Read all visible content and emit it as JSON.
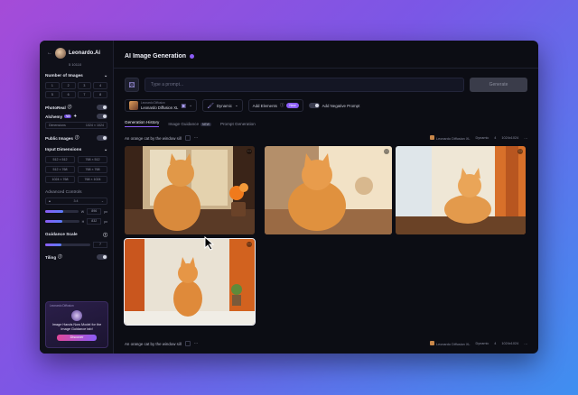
{
  "sidebar": {
    "brand": "Leonardo.Ai",
    "tokens": "5 10110",
    "number_of_images_label": "Number of Images",
    "image_counts": [
      "1",
      "2",
      "3",
      "4",
      "5",
      "6",
      "7",
      "8"
    ],
    "photoreal_label": "PhotoReal",
    "alchemy_label": "Alchemy",
    "alchemy_badge": "V2",
    "size_left": "Dimensions",
    "size_right": "1024 × 1024",
    "public_images_label": "Public Images",
    "input_dimensions_label": "Input Dimensions",
    "dimension_options": [
      "512 × 512",
      "768 × 512",
      "512 × 768",
      "768 × 768",
      "1024 × 768",
      "768 × 1024"
    ],
    "advanced_controls_label": "Advanced Controls",
    "aspect_value": "3:4",
    "width_key": "W",
    "width_value": "896",
    "height_key": "H",
    "height_value": "832",
    "unit": "px",
    "width_fraction": 0.55,
    "height_fraction": 0.5,
    "guidance_scale_label": "Guidance Scale",
    "guidance_value": "7",
    "guidance_fraction": 0.35,
    "tiling_label": "Tiling",
    "promo": {
      "top": "Leonardo Diffusion",
      "text": "Image Hands Now Model for the Image Guidance tab!",
      "button": "Discover"
    }
  },
  "main": {
    "title": "AI Image Generation",
    "prompt_placeholder": "Type a prompt...",
    "generate_label": "Generate",
    "model_small": "Leonardo Diffusion",
    "model_name": "Leonardo Diffusion XL",
    "style_label": "Dynamic",
    "add_elements_label": "Add Elements",
    "new_badge": "New",
    "negative_prompt_label": "Add Negative Prompt",
    "tabs": [
      "Generation History",
      "Image Guidance",
      "Prompt Generation"
    ],
    "tab_sub_badge": "NEW",
    "generation_prompt": "An orange cat by the window sill",
    "meta": [
      "Leonardo Diffusion XL",
      "Dynamic",
      "4",
      "1024x1024"
    ]
  },
  "colors": {
    "accent": "#8b5cf6",
    "window_bg": "#0c0d14",
    "sidebar_bg": "#0f1019"
  }
}
